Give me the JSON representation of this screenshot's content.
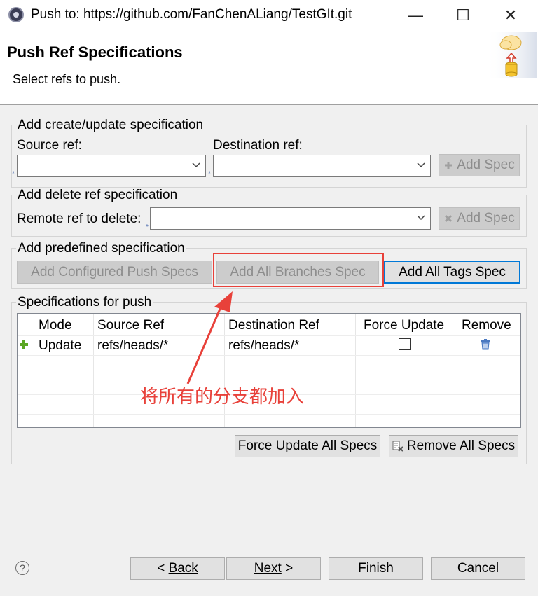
{
  "window": {
    "title": "Push to: https://github.com/FanChenALiang/TestGIt.git",
    "minimize_glyph": "—",
    "maximize_glyph": "☐",
    "close_glyph": "✕"
  },
  "header": {
    "title": "Push Ref Specifications",
    "subtitle": "Select refs to push."
  },
  "create_update": {
    "group_label": "Add create/update specification",
    "source_label": "Source ref:",
    "destination_label": "Destination ref:",
    "source_value": "",
    "destination_value": "",
    "add_spec_label": "Add Spec"
  },
  "delete_ref": {
    "group_label": "Add delete ref specification",
    "remote_label": "Remote ref to delete:",
    "remote_value": "",
    "add_spec_label": "Add Spec"
  },
  "predefined": {
    "group_label": "Add predefined specification",
    "configured_label": "Add Configured Push Specs",
    "all_branches_label": "Add All Branches Spec",
    "all_tags_label": "Add All Tags Spec"
  },
  "specs": {
    "group_label": "Specifications for push",
    "columns": [
      "Mode",
      "Source Ref",
      "Destination Ref",
      "Force Update",
      "Remove"
    ],
    "rows": [
      {
        "mode": "Update",
        "source": "refs/heads/*",
        "destination": "refs/heads/*",
        "force_update": false
      }
    ],
    "force_all_label": "Force Update All Specs",
    "remove_all_label": "Remove All Specs"
  },
  "annotation": {
    "text": "将所有的分支都加入",
    "color": "#e8413a"
  },
  "footer": {
    "help_glyph": "?",
    "back_label": "Back",
    "next_label": "Next",
    "finish_label": "Finish",
    "cancel_label": "Cancel"
  },
  "colors": {
    "accent": "#0078d7",
    "disabled_text": "#8d8d8d",
    "add_icon_green": "#5aa623",
    "trash_blue": "#4a78c0"
  }
}
